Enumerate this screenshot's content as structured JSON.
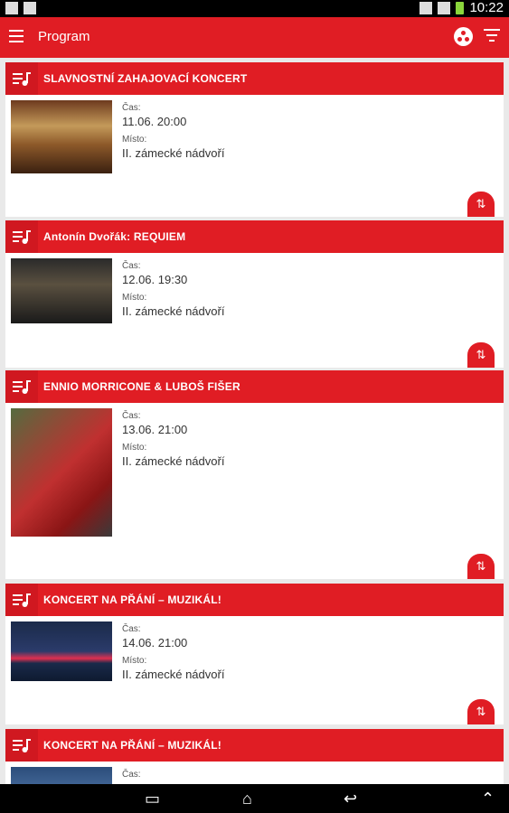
{
  "status": {
    "time": "10:22"
  },
  "appbar": {
    "title": "Program"
  },
  "events": [
    {
      "name": "SLAVNOSTNÍ ZAHAJOVACÍ KONCERT",
      "time_label": "Čas:",
      "time": "11.06. 20:00",
      "place_label": "Místo:",
      "place": "II. zámecké nádvoří"
    },
    {
      "name": "Antonín Dvořák: REQUIEM",
      "time_label": "Čas:",
      "time": "12.06. 19:30",
      "place_label": "Místo:",
      "place": "II. zámecké nádvoří"
    },
    {
      "name": "ENNIO MORRICONE & LUBOŠ FIŠER",
      "time_label": "Čas:",
      "time": "13.06. 21:00",
      "place_label": "Místo:",
      "place": "II. zámecké nádvoří"
    },
    {
      "name": "KONCERT NA PŘÁNÍ – MUZIKÁL!",
      "time_label": "Čas:",
      "time": "14.06. 21:00",
      "place_label": "Místo:",
      "place": "II. zámecké nádvoří"
    },
    {
      "name": "KONCERT NA PŘÁNÍ – MUZIKÁL!",
      "time_label": "Čas:",
      "time": "",
      "place_label": "",
      "place": ""
    }
  ]
}
